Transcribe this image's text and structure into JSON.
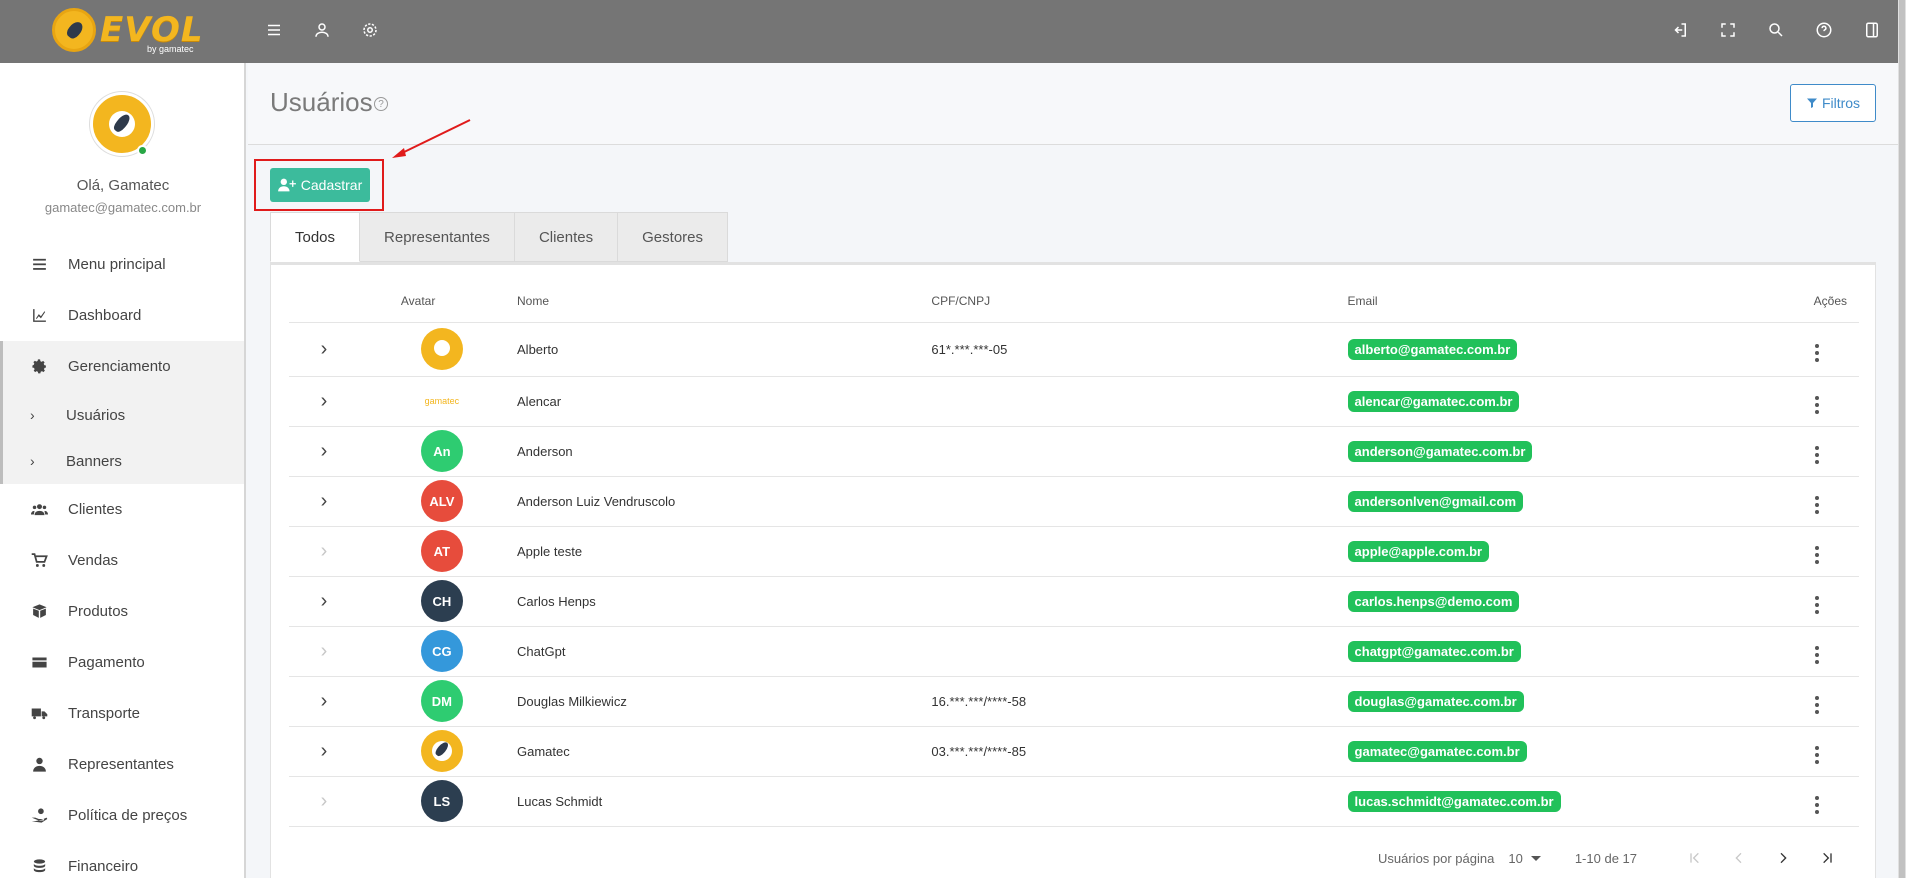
{
  "brand": {
    "name": "EVOL",
    "sub": "by gamatec",
    "accent": "#f3b61f"
  },
  "user": {
    "greeting": "Olá, Gamatec",
    "email": "gamatec@gamatec.com.br"
  },
  "sidebar": {
    "items": [
      {
        "label": "Menu principal",
        "icon": "list-icon"
      },
      {
        "label": "Dashboard",
        "icon": "chart-icon"
      },
      {
        "label": "Gerenciamento",
        "icon": "gear-icon"
      },
      {
        "label": "Usuários",
        "icon": "chevron-right-icon",
        "sub": true
      },
      {
        "label": "Banners",
        "icon": "chevron-right-icon",
        "sub": true
      },
      {
        "label": "Clientes",
        "icon": "users-icon"
      },
      {
        "label": "Vendas",
        "icon": "cart-icon"
      },
      {
        "label": "Produtos",
        "icon": "box-icon"
      },
      {
        "label": "Pagamento",
        "icon": "credit-card-icon"
      },
      {
        "label": "Transporte",
        "icon": "truck-icon"
      },
      {
        "label": "Representantes",
        "icon": "user-tie-icon"
      },
      {
        "label": "Política de preços",
        "icon": "hand-coin-icon"
      },
      {
        "label": "Financeiro",
        "icon": "coins-icon"
      }
    ]
  },
  "page": {
    "title": "Usuários",
    "filter_label": "Filtros",
    "add_label": "Cadastrar",
    "tabs": [
      "Todos",
      "Representantes",
      "Clientes",
      "Gestores"
    ]
  },
  "table": {
    "headers": {
      "avatar": "Avatar",
      "name": "Nome",
      "cpf": "CPF/CNPJ",
      "email": "Email",
      "actions": "Ações"
    },
    "rows": [
      {
        "avatar_type": "logo",
        "initials": "",
        "name": "Alberto",
        "cpf": "61*.***.***-05",
        "email": "alberto@gamatec.com.br",
        "expandable": true
      },
      {
        "avatar_type": "text-logo",
        "initials": "gamatec",
        "name": "Alencar",
        "cpf": "",
        "email": "alencar@gamatec.com.br",
        "expandable": true
      },
      {
        "avatar_type": "initials",
        "initials": "An",
        "color": "#2ecc71",
        "name": "Anderson",
        "cpf": "",
        "email": "anderson@gamatec.com.br",
        "expandable": true
      },
      {
        "avatar_type": "initials",
        "initials": "ALV",
        "color": "#e74c3c",
        "name": "Anderson Luiz Vendruscolo",
        "cpf": "",
        "email": "andersonlven@gmail.com",
        "expandable": true
      },
      {
        "avatar_type": "initials",
        "initials": "AT",
        "color": "#e74c3c",
        "name": "Apple teste",
        "cpf": "",
        "email": "apple@apple.com.br",
        "expandable": false
      },
      {
        "avatar_type": "initials",
        "initials": "CH",
        "color": "#2c3e50",
        "name": "Carlos Henps",
        "cpf": "",
        "email": "carlos.henps@demo.com",
        "expandable": true
      },
      {
        "avatar_type": "initials",
        "initials": "CG",
        "color": "#3498db",
        "name": "ChatGpt",
        "cpf": "",
        "email": "chatgpt@gamatec.com.br",
        "expandable": false
      },
      {
        "avatar_type": "initials",
        "initials": "DM",
        "color": "#2ecc71",
        "name": "Douglas Milkiewicz",
        "cpf": "16.***.***/****-58",
        "email": "douglas@gamatec.com.br",
        "expandable": true
      },
      {
        "avatar_type": "rocket",
        "initials": "",
        "name": "Gamatec",
        "cpf": "03.***.***/****-85",
        "email": "gamatec@gamatec.com.br",
        "expandable": true
      },
      {
        "avatar_type": "initials",
        "initials": "LS",
        "color": "#2c3e50",
        "name": "Lucas Schmidt",
        "cpf": "",
        "email": "lucas.schmidt@gamatec.com.br",
        "expandable": false
      }
    ]
  },
  "pagination": {
    "per_page_label": "Usuários por página",
    "per_page": "10",
    "range": "1-10 de 17"
  }
}
